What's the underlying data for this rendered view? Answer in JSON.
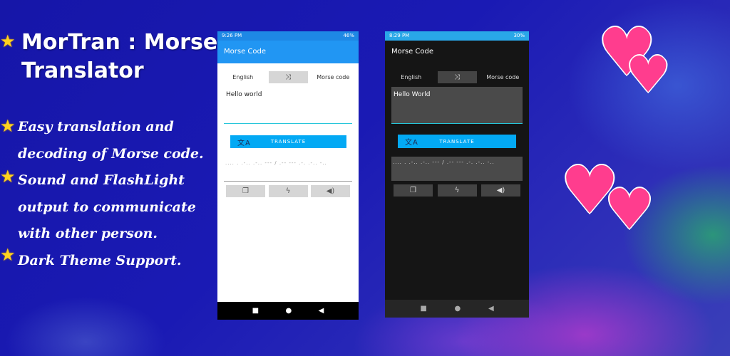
{
  "promo": {
    "title_line1": "MorTran : Morse",
    "title_line2": "Translator",
    "features": [
      "Easy translation and",
      "decoding of Morse code.",
      "Sound and FlashLight",
      "output to communicate",
      "with other person.",
      "Dark Theme Support."
    ]
  },
  "light_phone": {
    "status_time": "9:26 PM",
    "status_right": "46%",
    "app_title": "Morse Code",
    "lang_from": "English",
    "lang_to": "Morse code",
    "input_text": "Hello world",
    "translate_label": "TRANSLATE",
    "output_text": ".... . .-.. .-.. --- / .-- --- .-. .-.. -.."
  },
  "dark_phone": {
    "status_time": "8:29 PM",
    "status_right": "30%",
    "app_title": "Morse Code",
    "lang_from": "English",
    "lang_to": "Morse code",
    "input_text": "Hello World",
    "translate_label": "TRANSLATE",
    "output_text": ".... . .-.. .-.. --- / .-- --- .-. .-.. -.."
  },
  "icons": {
    "swap": "⤨",
    "translate": "文A",
    "copy": "❐",
    "flash": "ϟ",
    "sound": "◀)",
    "nav_square": "■",
    "nav_circle": "●",
    "nav_back": "◀",
    "star": "★",
    "heart": "♥"
  },
  "colors": {
    "background": "#1b1bb0",
    "primary": "#2196f3",
    "button": "#03a9f4",
    "accent_line": "#26c6da",
    "heart": "#ff3d8e",
    "star": "#ffd21f"
  }
}
